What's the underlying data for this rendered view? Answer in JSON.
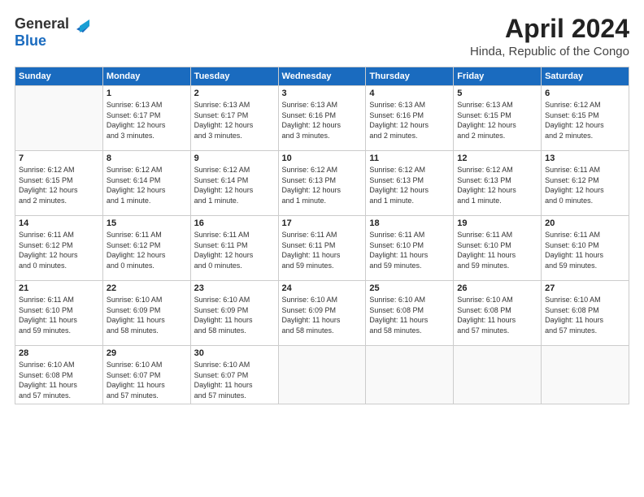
{
  "logo": {
    "general": "General",
    "blue": "Blue"
  },
  "title": "April 2024",
  "location": "Hinda, Republic of the Congo",
  "days_of_week": [
    "Sunday",
    "Monday",
    "Tuesday",
    "Wednesday",
    "Thursday",
    "Friday",
    "Saturday"
  ],
  "weeks": [
    [
      {
        "num": "",
        "info": ""
      },
      {
        "num": "1",
        "info": "Sunrise: 6:13 AM\nSunset: 6:17 PM\nDaylight: 12 hours\nand 3 minutes."
      },
      {
        "num": "2",
        "info": "Sunrise: 6:13 AM\nSunset: 6:17 PM\nDaylight: 12 hours\nand 3 minutes."
      },
      {
        "num": "3",
        "info": "Sunrise: 6:13 AM\nSunset: 6:16 PM\nDaylight: 12 hours\nand 3 minutes."
      },
      {
        "num": "4",
        "info": "Sunrise: 6:13 AM\nSunset: 6:16 PM\nDaylight: 12 hours\nand 2 minutes."
      },
      {
        "num": "5",
        "info": "Sunrise: 6:13 AM\nSunset: 6:15 PM\nDaylight: 12 hours\nand 2 minutes."
      },
      {
        "num": "6",
        "info": "Sunrise: 6:12 AM\nSunset: 6:15 PM\nDaylight: 12 hours\nand 2 minutes."
      }
    ],
    [
      {
        "num": "7",
        "info": "Sunrise: 6:12 AM\nSunset: 6:15 PM\nDaylight: 12 hours\nand 2 minutes."
      },
      {
        "num": "8",
        "info": "Sunrise: 6:12 AM\nSunset: 6:14 PM\nDaylight: 12 hours\nand 1 minute."
      },
      {
        "num": "9",
        "info": "Sunrise: 6:12 AM\nSunset: 6:14 PM\nDaylight: 12 hours\nand 1 minute."
      },
      {
        "num": "10",
        "info": "Sunrise: 6:12 AM\nSunset: 6:13 PM\nDaylight: 12 hours\nand 1 minute."
      },
      {
        "num": "11",
        "info": "Sunrise: 6:12 AM\nSunset: 6:13 PM\nDaylight: 12 hours\nand 1 minute."
      },
      {
        "num": "12",
        "info": "Sunrise: 6:12 AM\nSunset: 6:13 PM\nDaylight: 12 hours\nand 1 minute."
      },
      {
        "num": "13",
        "info": "Sunrise: 6:11 AM\nSunset: 6:12 PM\nDaylight: 12 hours\nand 0 minutes."
      }
    ],
    [
      {
        "num": "14",
        "info": "Sunrise: 6:11 AM\nSunset: 6:12 PM\nDaylight: 12 hours\nand 0 minutes."
      },
      {
        "num": "15",
        "info": "Sunrise: 6:11 AM\nSunset: 6:12 PM\nDaylight: 12 hours\nand 0 minutes."
      },
      {
        "num": "16",
        "info": "Sunrise: 6:11 AM\nSunset: 6:11 PM\nDaylight: 12 hours\nand 0 minutes."
      },
      {
        "num": "17",
        "info": "Sunrise: 6:11 AM\nSunset: 6:11 PM\nDaylight: 11 hours\nand 59 minutes."
      },
      {
        "num": "18",
        "info": "Sunrise: 6:11 AM\nSunset: 6:10 PM\nDaylight: 11 hours\nand 59 minutes."
      },
      {
        "num": "19",
        "info": "Sunrise: 6:11 AM\nSunset: 6:10 PM\nDaylight: 11 hours\nand 59 minutes."
      },
      {
        "num": "20",
        "info": "Sunrise: 6:11 AM\nSunset: 6:10 PM\nDaylight: 11 hours\nand 59 minutes."
      }
    ],
    [
      {
        "num": "21",
        "info": "Sunrise: 6:11 AM\nSunset: 6:10 PM\nDaylight: 11 hours\nand 59 minutes."
      },
      {
        "num": "22",
        "info": "Sunrise: 6:10 AM\nSunset: 6:09 PM\nDaylight: 11 hours\nand 58 minutes."
      },
      {
        "num": "23",
        "info": "Sunrise: 6:10 AM\nSunset: 6:09 PM\nDaylight: 11 hours\nand 58 minutes."
      },
      {
        "num": "24",
        "info": "Sunrise: 6:10 AM\nSunset: 6:09 PM\nDaylight: 11 hours\nand 58 minutes."
      },
      {
        "num": "25",
        "info": "Sunrise: 6:10 AM\nSunset: 6:08 PM\nDaylight: 11 hours\nand 58 minutes."
      },
      {
        "num": "26",
        "info": "Sunrise: 6:10 AM\nSunset: 6:08 PM\nDaylight: 11 hours\nand 57 minutes."
      },
      {
        "num": "27",
        "info": "Sunrise: 6:10 AM\nSunset: 6:08 PM\nDaylight: 11 hours\nand 57 minutes."
      }
    ],
    [
      {
        "num": "28",
        "info": "Sunrise: 6:10 AM\nSunset: 6:08 PM\nDaylight: 11 hours\nand 57 minutes."
      },
      {
        "num": "29",
        "info": "Sunrise: 6:10 AM\nSunset: 6:07 PM\nDaylight: 11 hours\nand 57 minutes."
      },
      {
        "num": "30",
        "info": "Sunrise: 6:10 AM\nSunset: 6:07 PM\nDaylight: 11 hours\nand 57 minutes."
      },
      {
        "num": "",
        "info": ""
      },
      {
        "num": "",
        "info": ""
      },
      {
        "num": "",
        "info": ""
      },
      {
        "num": "",
        "info": ""
      }
    ]
  ]
}
